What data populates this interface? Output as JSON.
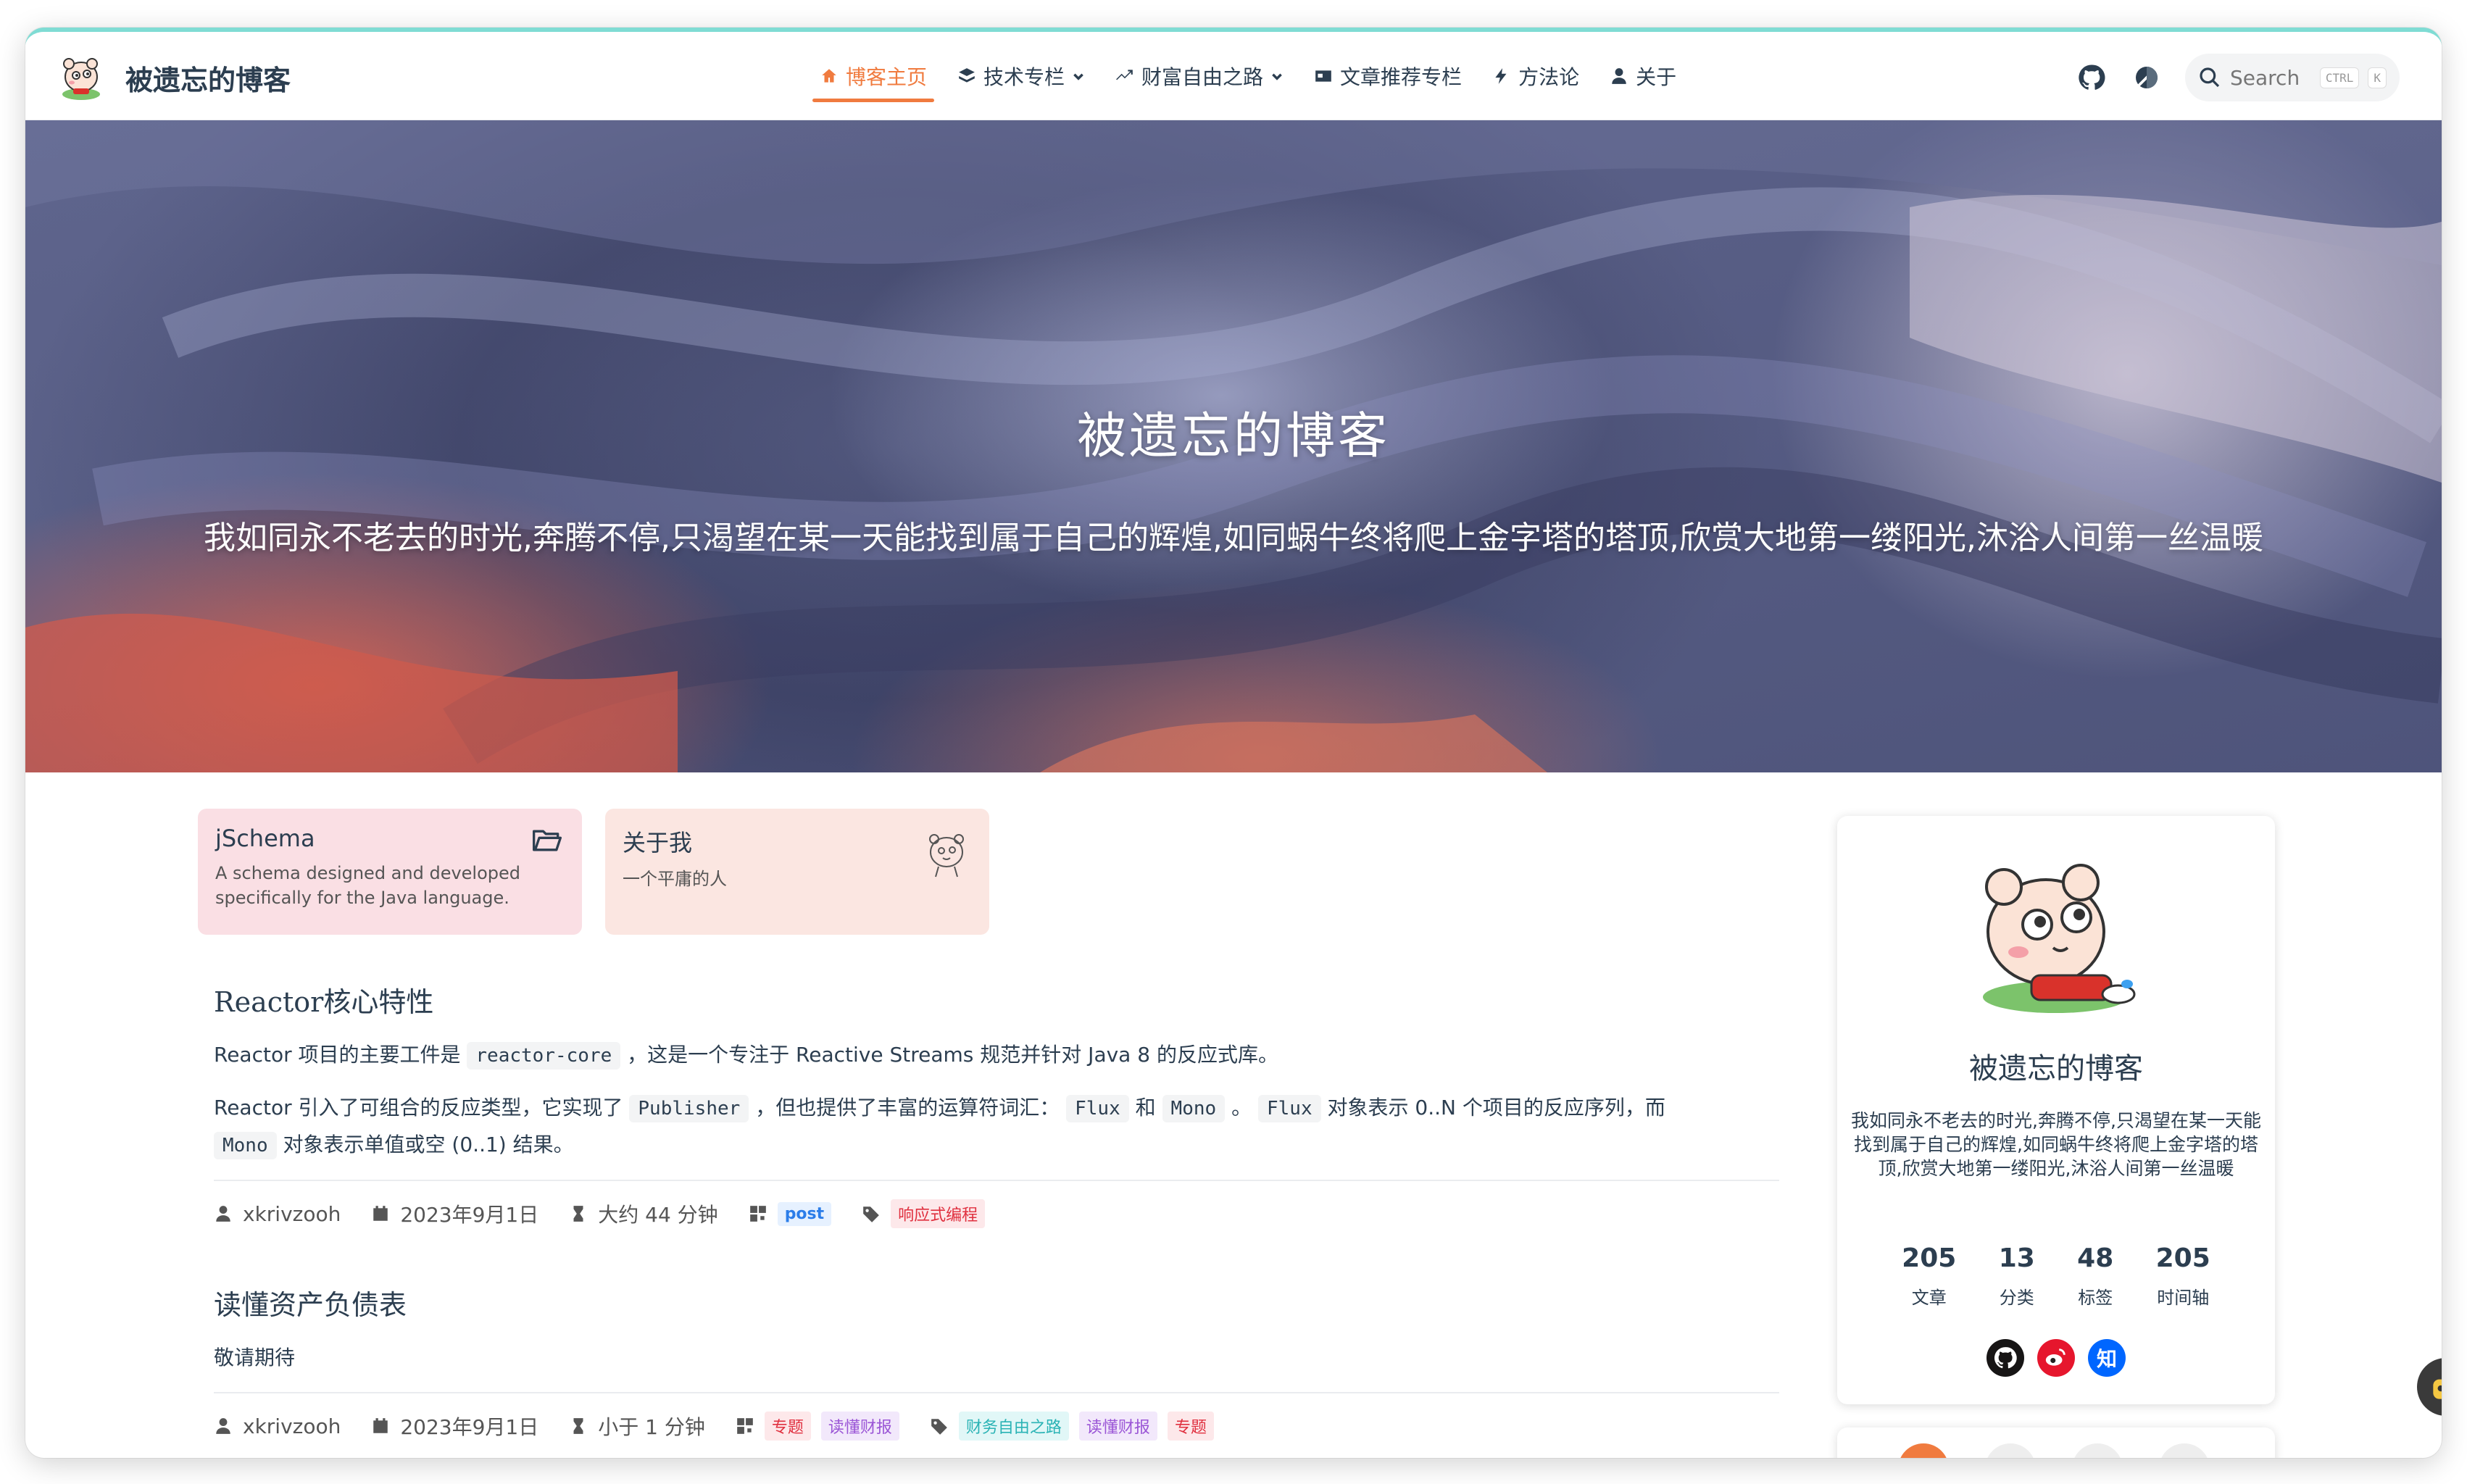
{
  "navbar": {
    "brand_title": "被遗忘的博客",
    "links": [
      {
        "label": "博客主页",
        "icon": "home-icon",
        "active": true
      },
      {
        "label": "技术专栏",
        "icon": "layers-icon",
        "dropdown": true
      },
      {
        "label": "财富自由之路",
        "icon": "trend-icon",
        "dropdown": true
      },
      {
        "label": "文章推荐专栏",
        "icon": "card-icon"
      },
      {
        "label": "方法论",
        "icon": "bolt-icon"
      },
      {
        "label": "关于",
        "icon": "user-icon"
      }
    ],
    "search_placeholder": "Search",
    "search_kbd_ctrl": "CTRL",
    "search_kbd_k": "K",
    "accent_color": "#f07b3f"
  },
  "hero": {
    "title": "被遗忘的博客",
    "subtitle": "我如同永不老去的时光,奔腾不停,只渴望在某一天能找到属于自己的辉煌,如同蜗牛终将爬上金字塔的塔顶,欣赏大地第一缕阳光,沐浴人间第一丝温暖"
  },
  "cards": [
    {
      "title": "jSchema",
      "desc": "A schema designed and developed specifically for the Java language.",
      "icon": "folder-open-icon"
    },
    {
      "title": "关于我",
      "desc": "一个平庸的人",
      "icon": "avatar-icon"
    }
  ],
  "articles": [
    {
      "title": "Reactor核心特性",
      "p1_a": "Reactor 项目的主要工件是 ",
      "p1_code": "reactor-core",
      "p1_b": " ，这是一个专注于 Reactive Streams 规范并针对 Java 8 的反应式库。",
      "p2_a": "Reactor 引入了可组合的反应类型，它实现了 ",
      "p2_code1": "Publisher",
      "p2_b": " ，但也提供了丰富的运算符词汇： ",
      "p2_code2": "Flux",
      "p2_c": " 和 ",
      "p2_code3": "Mono",
      "p2_d": " 。 ",
      "p2_code4": "Flux",
      "p2_e": " 对象表示 0..N 个项目的反应序列，而",
      "p2_code5": "Mono",
      "p2_f": " 对象表示单值或空 (0..1) 结果。",
      "author": "xkrivzooh",
      "date": "2023年9月1日",
      "read_time": "大约 44 分钟",
      "categories": [
        "post"
      ],
      "tags": [
        "响应式编程"
      ]
    },
    {
      "title": "读懂资产负债表",
      "body": "敬请期待",
      "author": "xkrivzooh",
      "date": "2023年9月1日",
      "read_time": "小于 1 分钟",
      "categories": [
        "专题",
        "读懂财报"
      ],
      "tags": [
        "财务自由之路",
        "读懂财报",
        "专题"
      ]
    }
  ],
  "sidebar": {
    "name": "被遗忘的博客",
    "desc": "我如同永不老去的时光,奔腾不停,只渴望在某一天能找到属于自己的辉煌,如同蜗牛终将爬上金字塔的塔顶,欣赏大地第一缕阳光,沐浴人间第一丝温暖",
    "stats": [
      {
        "num": "205",
        "label": "文章"
      },
      {
        "num": "13",
        "label": "分类"
      },
      {
        "num": "48",
        "label": "标签"
      },
      {
        "num": "205",
        "label": "时间轴"
      }
    ],
    "socials": [
      {
        "name": "github-icon",
        "color": "#171515"
      },
      {
        "name": "weibo-icon",
        "color": "#e6162d"
      },
      {
        "name": "zhihu-icon",
        "color": "#0066ff",
        "label": "知"
      }
    ]
  }
}
